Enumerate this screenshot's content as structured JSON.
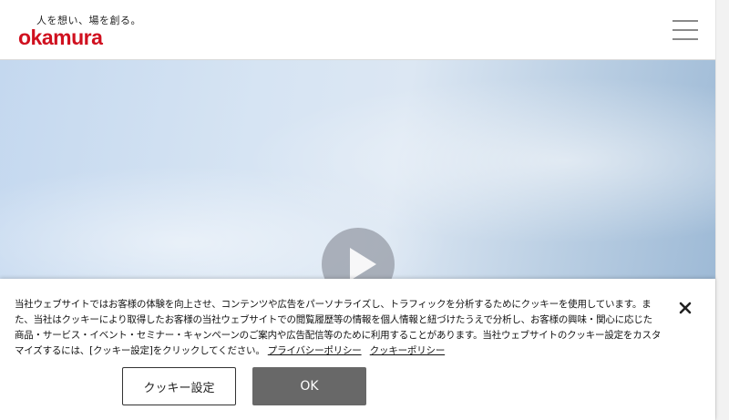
{
  "header": {
    "tagline": "人を想い、場を創る。",
    "logo_text": "okamura",
    "menu_icon": "hamburger-menu-icon"
  },
  "hero": {
    "play_icon": "play-icon"
  },
  "cookie_banner": {
    "text": "当社ウェブサイトではお客様の体験を向上させ、コンテンツや広告をパーソナライズし、トラフィックを分析するためにクッキーを使用しています。また、当社はクッキーにより取得したお客様の当社ウェブサイトでの閲覧履歴等の情報を個人情報と紐づけたうえで分析し、お客様の興味・関心に応じた商品・サービス・イベント・セミナー・キャンペーンのご案内や広告配信等のために利用することがあります。当社ウェブサイトのクッキー設定をカスタマイズするには、[クッキー設定]をクリックしてください。",
    "privacy_link": "プライバシーポリシー",
    "cookie_link": "クッキーポリシー",
    "settings_button": "クッキー設定",
    "ok_button": "OK",
    "close_icon": "close-icon"
  },
  "colors": {
    "brand_red": "#d0101f",
    "ok_button_bg": "#686868"
  }
}
